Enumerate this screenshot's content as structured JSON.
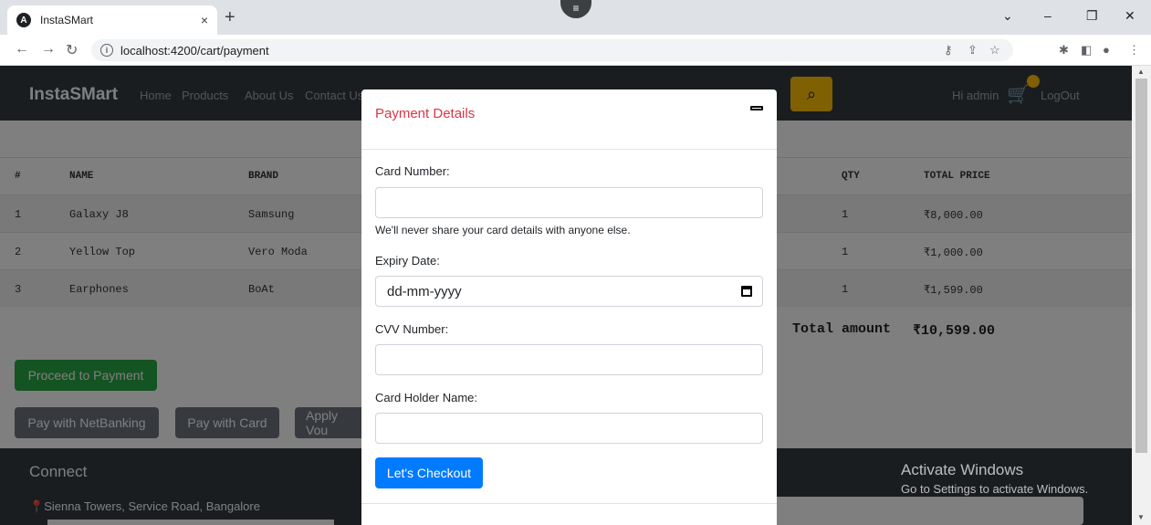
{
  "browser": {
    "tab_title": "InstaSMart",
    "favicon_letter": "A",
    "tab_close": "×",
    "new_tab": "+",
    "url": "localhost:4200/cart/payment"
  },
  "navbar": {
    "brand": "InstaSMart",
    "links": [
      "Home",
      "Products",
      "About Us",
      "Contact Us"
    ],
    "greeting": "Hi admin",
    "logout": "LogOut"
  },
  "cart": {
    "headers": [
      "#",
      "NAME",
      "BRAND",
      "QTY",
      "TOTAL PRICE"
    ],
    "rows": [
      {
        "num": "1",
        "name": "Galaxy J8",
        "brand": "Samsung",
        "qty": "1",
        "price": "₹8,000.00"
      },
      {
        "num": "2",
        "name": "Yellow Top",
        "brand": "Vero Moda",
        "qty": "1",
        "price": "₹1,000.00"
      },
      {
        "num": "3",
        "name": "Earphones",
        "brand": "BoAt",
        "qty": "1",
        "price": "₹1,599.00"
      }
    ],
    "total_label": "Total amount",
    "total_value": "₹10,599.00"
  },
  "buttons": {
    "proceed": "Proceed to Payment",
    "netbanking": "Pay with NetBanking",
    "card": "Pay with Card",
    "voucher": "Apply Vou"
  },
  "footer": {
    "connect": "Connect",
    "address": "Sienna Towers, Service Road, Bangalore",
    "activate_title": "Activate Windows",
    "activate_sub": "Go to Settings to activate Windows."
  },
  "modal": {
    "title": "Payment Details",
    "card_number_label": "Card Number:",
    "card_help": "We'll never share your card details with anyone else.",
    "expiry_label": "Expiry Date:",
    "expiry_placeholder": "dd-mm-yyyy",
    "cvv_label": "CVV Number:",
    "holder_label": "Card Holder Name:",
    "checkout": "Let's Checkout"
  },
  "colors": {
    "navbar": "#343a40",
    "accent_yellow": "#ffc107",
    "primary": "#007bff",
    "success": "#28a745",
    "danger": "#dc3545"
  }
}
